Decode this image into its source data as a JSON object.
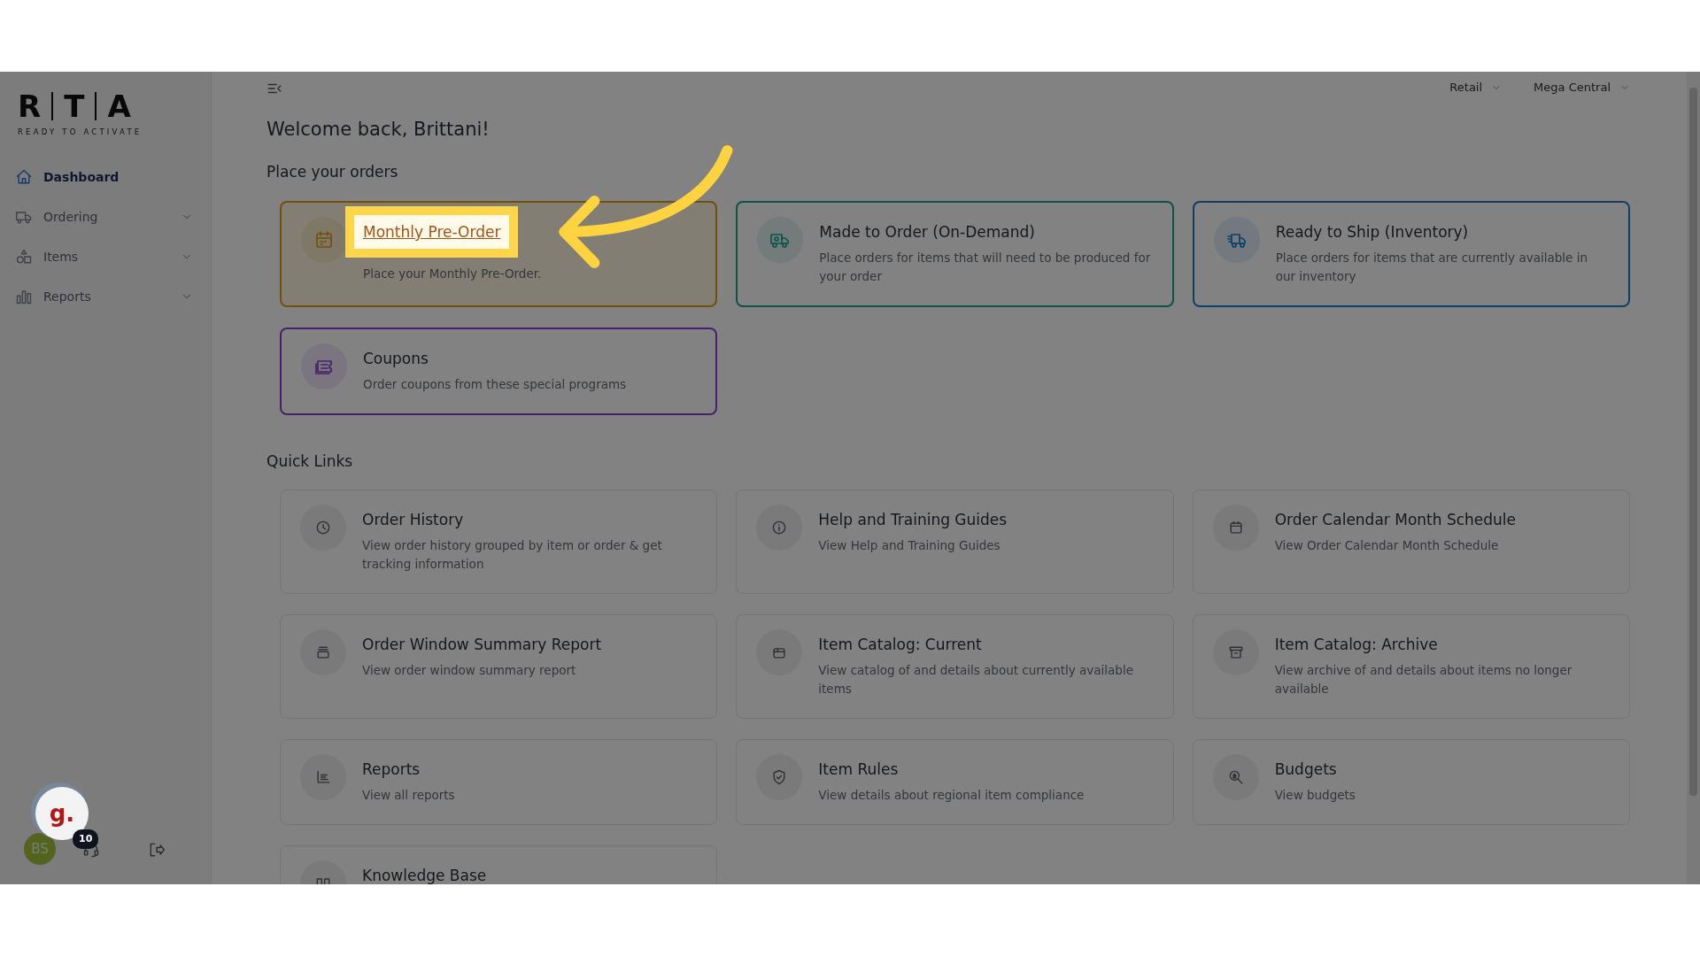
{
  "dimmed": true,
  "brand": {
    "letters": [
      "R",
      "T",
      "A"
    ],
    "tagline": "READY TO ACTIVATE"
  },
  "sidebar": {
    "items": [
      {
        "label": "Dashboard",
        "selected": true,
        "submenu": false
      },
      {
        "label": "Ordering",
        "selected": false,
        "submenu": true
      },
      {
        "label": "Items",
        "selected": false,
        "submenu": true
      },
      {
        "label": "Reports",
        "selected": false,
        "submenu": true
      }
    ]
  },
  "footer": {
    "avatar_initials": "BS",
    "widget_logo": "g.",
    "widget_badge": "10"
  },
  "topbar": {
    "dropdowns": [
      {
        "label": "Retail"
      },
      {
        "label": "Mega Central"
      }
    ]
  },
  "welcome": "Welcome back, Brittani!",
  "orders_heading": "Place your orders",
  "order_cards": [
    {
      "title": "Monthly Pre-Order",
      "description": "Place your Monthly Pre-Order.",
      "color": "#724f0e",
      "highlighted": true
    },
    {
      "title": "Made to Order (On-Demand)",
      "description": "Place orders for items that will need to be produced for your order",
      "color": "#0c5448",
      "highlighted": false
    },
    {
      "title": "Ready to Ship (Inventory)",
      "description": "Place orders for items that are currently available in our inventory",
      "color": "#0e4164",
      "highlighted": false
    },
    {
      "title": "Coupons",
      "description": "Order coupons from these special programs",
      "color": "#46206b",
      "highlighted": false
    }
  ],
  "quick_links_heading": "Quick Links",
  "quick_links": [
    {
      "title": "Order History",
      "description": "View order history grouped by item or order & get tracking information"
    },
    {
      "title": "Help and Training Guides",
      "description": "View Help and Training Guides"
    },
    {
      "title": "Order Calendar Month Schedule",
      "description": "View Order Calendar Month Schedule"
    },
    {
      "title": "Order Window Summary Report",
      "description": "View order window summary report"
    },
    {
      "title": "Item Catalog: Current",
      "description": "View catalog of and details about currently available items"
    },
    {
      "title": "Item Catalog: Archive",
      "description": "View archive of and details about items no longer available"
    },
    {
      "title": "Reports",
      "description": "View all reports"
    },
    {
      "title": "Item Rules",
      "description": "View details about regional item compliance"
    },
    {
      "title": "Budgets",
      "description": "View budgets"
    },
    {
      "title": "Knowledge Base"
    }
  ]
}
